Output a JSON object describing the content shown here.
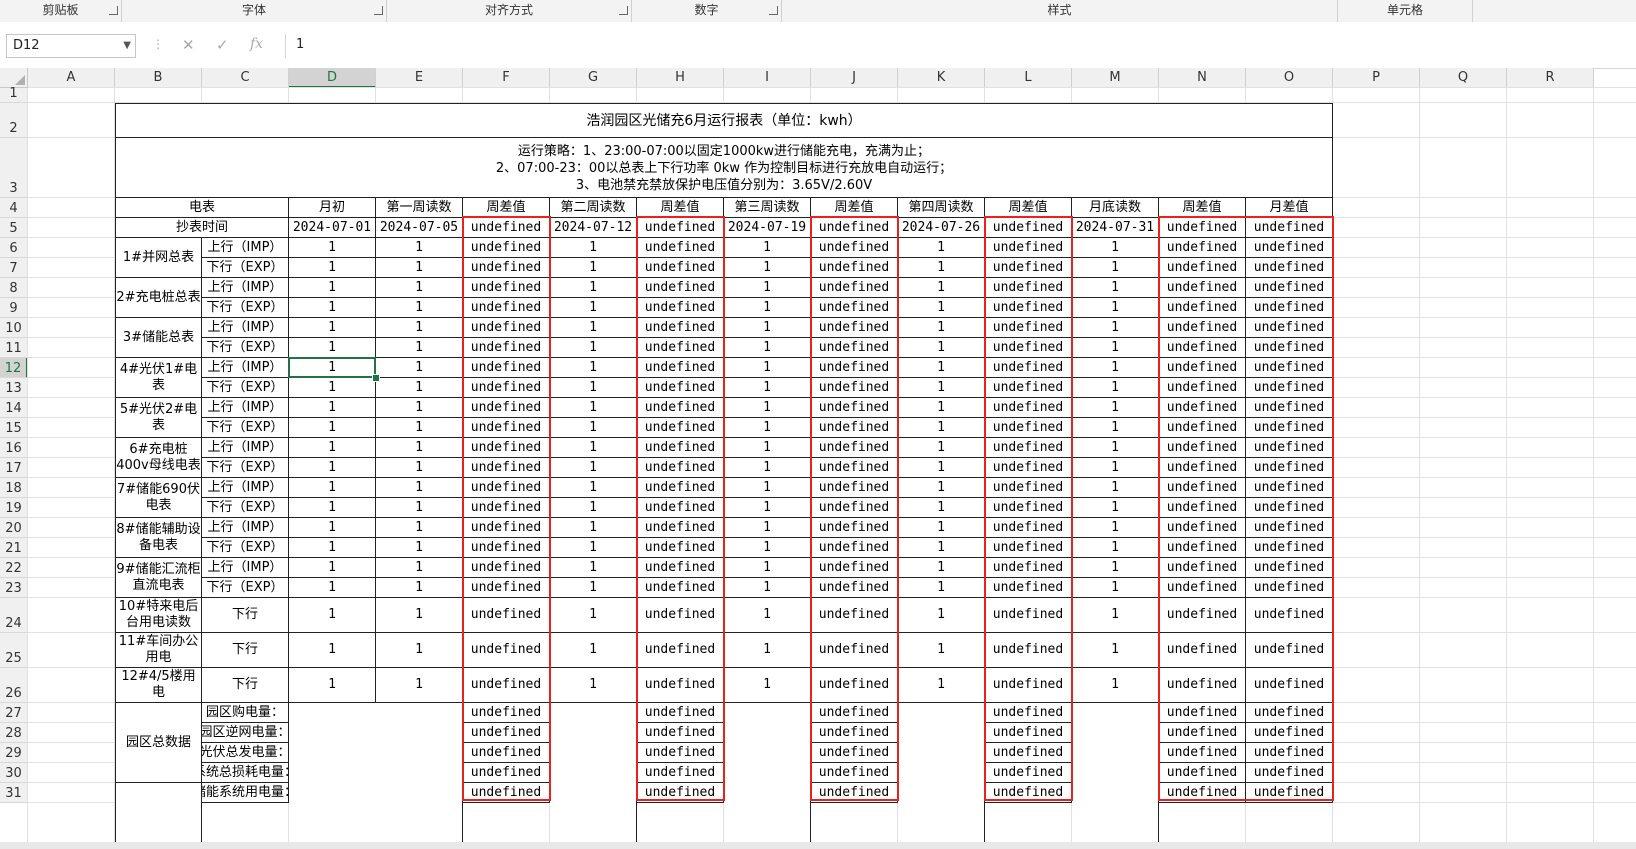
{
  "ribbon": {
    "groups": [
      {
        "label": "剪贴板"
      },
      {
        "label": "字体"
      },
      {
        "label": "对齐方式"
      },
      {
        "label": "数字"
      },
      {
        "label": "样式"
      },
      {
        "label": "单元格"
      }
    ]
  },
  "formula_bar": {
    "name_box": "D12",
    "cancel_icon": "✕",
    "enter_icon": "✓",
    "fx_label": "fx",
    "value": "1"
  },
  "columns": [
    "A",
    "B",
    "C",
    "D",
    "E",
    "F",
    "G",
    "H",
    "I",
    "J",
    "K",
    "L",
    "M",
    "N",
    "O",
    "P",
    "Q",
    "R"
  ],
  "rows": [
    "1",
    "2",
    "3",
    "4",
    "5",
    "6",
    "7",
    "8",
    "9",
    "10",
    "11",
    "12",
    "13",
    "14",
    "15",
    "16",
    "17",
    "18",
    "19",
    "20",
    "21",
    "22",
    "23",
    "24",
    "25",
    "26",
    "27",
    "28",
    "29",
    "30",
    "31"
  ],
  "active_cell": {
    "column": "D",
    "row": "12"
  },
  "report": {
    "title": "浩润园区光储充6月运行报表（单位：kwh）",
    "strategy_lines": [
      "运行策略：1、23:00-07:00以固定1000kw进行储能充电，充满为止；",
      "2、07:00-23：00以总表上下行功率 0kw 作为控制目标进行充放电自动运行；",
      "3、电池禁充禁放保护电压值分别为：3.65V/2.60V"
    ],
    "headers": {
      "meter": "电表",
      "month_start": "月初",
      "week1": "第一周读数",
      "week_diff": "周差值",
      "week2": "第二周读数",
      "week3": "第三周读数",
      "week4": "第四周读数",
      "month_end": "月底读数",
      "month_diff": "月差值",
      "read_time": "抄表时间"
    },
    "dates": {
      "month_start": "2024-07-01",
      "week1": "2024-07-05",
      "week2": "2024-07-12",
      "week3": "2024-07-19",
      "week4": "2024-07-26",
      "month_end": "2024-07-31"
    },
    "placeholder_value": "undefined",
    "reading_value": "1",
    "direction_up": "上行（IMP）",
    "direction_down": "下行（EXP）",
    "direction_down_only": "下行",
    "meters": [
      {
        "name": "1#并网总表"
      },
      {
        "name": "2#充电桩总表"
      },
      {
        "name": "3#储能总表"
      },
      {
        "name": "4#光伏1#电表"
      },
      {
        "name": "5#光伏2#电表"
      },
      {
        "name": "6#充电桩400v母线电表"
      },
      {
        "name": "7#储能690伏电表"
      },
      {
        "name": "8#储能辅助设备电表"
      },
      {
        "name": "9#储能汇流柜直流电表"
      }
    ],
    "single_meters": [
      {
        "name": "10#特来电后台用电读数"
      },
      {
        "name": "11#车间办公用电"
      },
      {
        "name": "12#4/5楼用电"
      }
    ],
    "park_total_label": "园区总数据",
    "park_items": [
      {
        "label": "园区购电量："
      },
      {
        "label": "园区逆网电量："
      },
      {
        "label": "光伏总发电量："
      },
      {
        "label": "系统总损耗电量："
      },
      {
        "label": "储能系统用电量："
      }
    ]
  },
  "highlight_color": "#e8221f",
  "selection_color": "#217346"
}
